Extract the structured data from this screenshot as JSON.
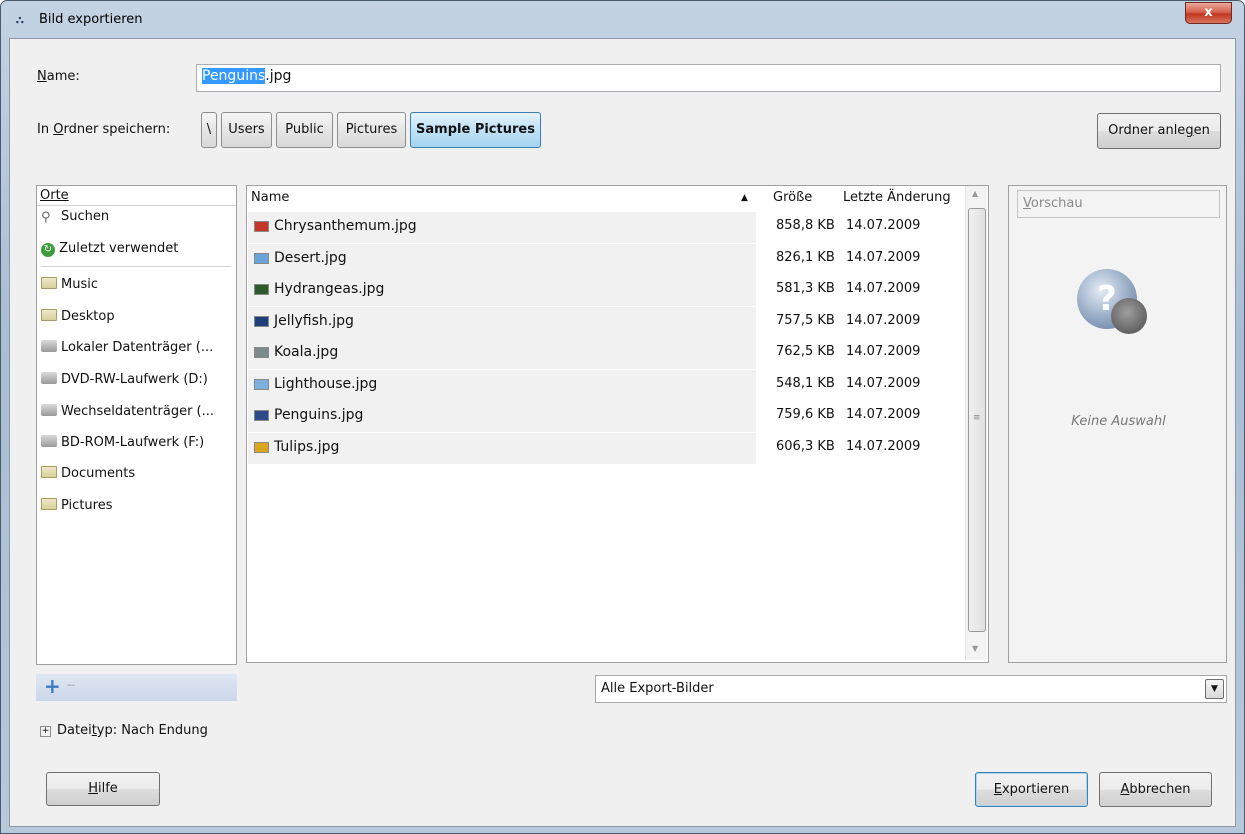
{
  "window": {
    "title": "Bild exportieren",
    "close_label": "x",
    "app_icon": "gimp-icon"
  },
  "name_row": {
    "label": "Name:",
    "label_accel": "N",
    "label_rest": "ame:",
    "value_selected": "Penguins",
    "value_rest": ".jpg"
  },
  "folder_row": {
    "label_pre": "In ",
    "label_accel": "O",
    "label_rest": "rdner speichern:",
    "crumbs": [
      "\\",
      "Users",
      "Public",
      "Pictures",
      "Sample Pictures"
    ],
    "new_folder": {
      "pre": "Ordner anle",
      "accel": "g",
      "post": "en"
    }
  },
  "places": {
    "header": "Orte",
    "items": [
      {
        "label": "Suchen",
        "icon": "search-icon"
      },
      {
        "label": "Zuletzt verwendet",
        "icon": "recent-icon"
      },
      {
        "label": "Music",
        "icon": "folder-icon"
      },
      {
        "label": "Desktop",
        "icon": "folder-icon"
      },
      {
        "label": "Lokaler Datenträger (...",
        "icon": "drive-icon"
      },
      {
        "label": "DVD-RW-Laufwerk (D:)",
        "icon": "optical-drive-icon"
      },
      {
        "label": "Wechseldatenträger (...",
        "icon": "removable-drive-icon"
      },
      {
        "label": "BD-ROM-Laufwerk (F:)",
        "icon": "optical-drive-icon"
      },
      {
        "label": "Documents",
        "icon": "folder-icon"
      },
      {
        "label": "Pictures",
        "icon": "folder-icon"
      }
    ]
  },
  "files": {
    "columns": {
      "name": "Name",
      "size": "Größe",
      "date": "Letzte Änderung"
    },
    "rows": [
      {
        "name": "Chrysanthemum.jpg",
        "size": "858,8 KB",
        "date": "14.07.2009",
        "color": "#c4362a"
      },
      {
        "name": "Desert.jpg",
        "size": "826,1 KB",
        "date": "14.07.2009",
        "color": "#6aa3d8"
      },
      {
        "name": "Hydrangeas.jpg",
        "size": "581,3 KB",
        "date": "14.07.2009",
        "color": "#2d5a2a"
      },
      {
        "name": "Jellyfish.jpg",
        "size": "757,5 KB",
        "date": "14.07.2009",
        "color": "#1d3f7a"
      },
      {
        "name": "Koala.jpg",
        "size": "762,5 KB",
        "date": "14.07.2009",
        "color": "#7c8a8a"
      },
      {
        "name": "Lighthouse.jpg",
        "size": "548,1 KB",
        "date": "14.07.2009",
        "color": "#7eb0de"
      },
      {
        "name": "Penguins.jpg",
        "size": "759,6 KB",
        "date": "14.07.2009",
        "color": "#2a4a8a"
      },
      {
        "name": "Tulips.jpg",
        "size": "606,3 KB",
        "date": "14.07.2009",
        "color": "#d9a71c"
      }
    ]
  },
  "preview": {
    "label_accel": "V",
    "label_rest": "orschau",
    "no_selection": "Keine Auswahl"
  },
  "filter": {
    "value": "Alle Export-Bilder"
  },
  "filetype": {
    "pre": "Datei",
    "accel": "t",
    "post": "yp: Nach Endung"
  },
  "buttons": {
    "help": {
      "accel": "H",
      "rest": "ilfe"
    },
    "export": {
      "accel": "E",
      "rest": "xportieren"
    },
    "cancel": {
      "accel": "A",
      "rest": "bbrechen"
    }
  }
}
